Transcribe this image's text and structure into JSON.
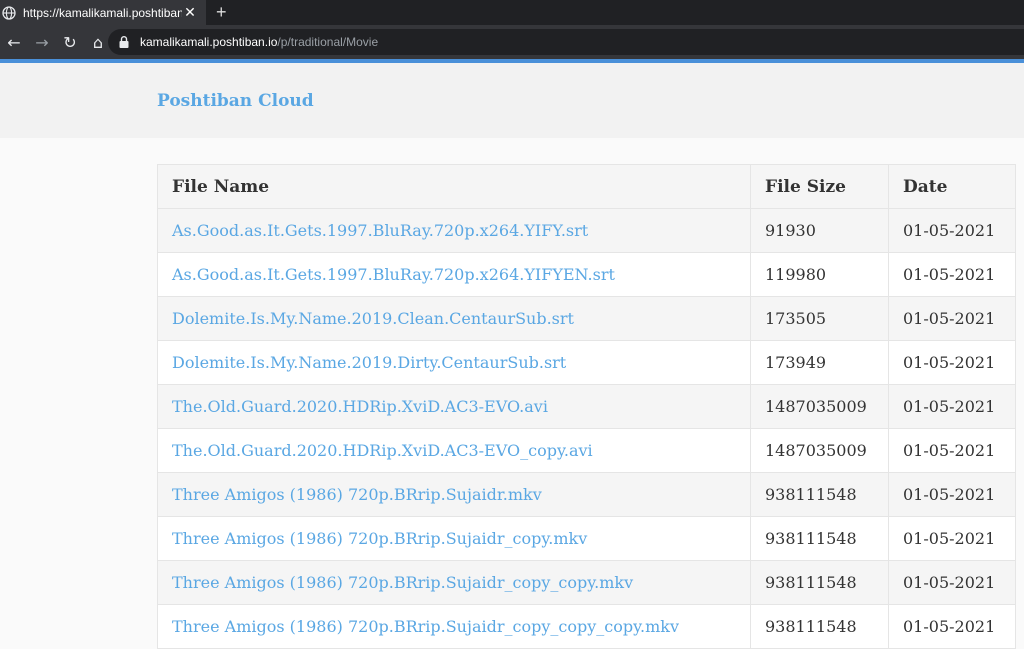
{
  "browser": {
    "tab_title": "https://kamalikamali.poshtiban.io",
    "new_tab": "+",
    "url_host": "kamalikamali.poshtiban.io",
    "url_path": "/p/traditional/Movie"
  },
  "site": {
    "brand": "Poshtiban Cloud"
  },
  "table": {
    "headers": {
      "name": "File Name",
      "size": "File Size",
      "date": "Date"
    },
    "rows": [
      {
        "name": "As.Good.as.It.Gets.1997.BluRay.720p.x264.YIFY.srt",
        "size": "91930",
        "date": "01-05-2021"
      },
      {
        "name": "As.Good.as.It.Gets.1997.BluRay.720p.x264.YIFYEN.srt",
        "size": "119980",
        "date": "01-05-2021"
      },
      {
        "name": "Dolemite.Is.My.Name.2019.Clean.CentaurSub.srt",
        "size": "173505",
        "date": "01-05-2021"
      },
      {
        "name": "Dolemite.Is.My.Name.2019.Dirty.CentaurSub.srt",
        "size": "173949",
        "date": "01-05-2021"
      },
      {
        "name": "The.Old.Guard.2020.HDRip.XviD.AC3-EVO.avi",
        "size": "1487035009",
        "date": "01-05-2021"
      },
      {
        "name": "The.Old.Guard.2020.HDRip.XviD.AC3-EVO_copy.avi",
        "size": "1487035009",
        "date": "01-05-2021"
      },
      {
        "name": "Three Amigos (1986) 720p.BRrip.Sujaidr.mkv",
        "size": "938111548",
        "date": "01-05-2021"
      },
      {
        "name": "Three Amigos (1986) 720p.BRrip.Sujaidr_copy.mkv",
        "size": "938111548",
        "date": "01-05-2021"
      },
      {
        "name": "Three Amigos (1986) 720p.BRrip.Sujaidr_copy_copy.mkv",
        "size": "938111548",
        "date": "01-05-2021"
      },
      {
        "name": "Three Amigos (1986) 720p.BRrip.Sujaidr_copy_copy_copy.mkv",
        "size": "938111548",
        "date": "01-05-2021"
      }
    ]
  },
  "colors": {
    "accent": "#4a90d9",
    "link": "#5aa7e3"
  }
}
